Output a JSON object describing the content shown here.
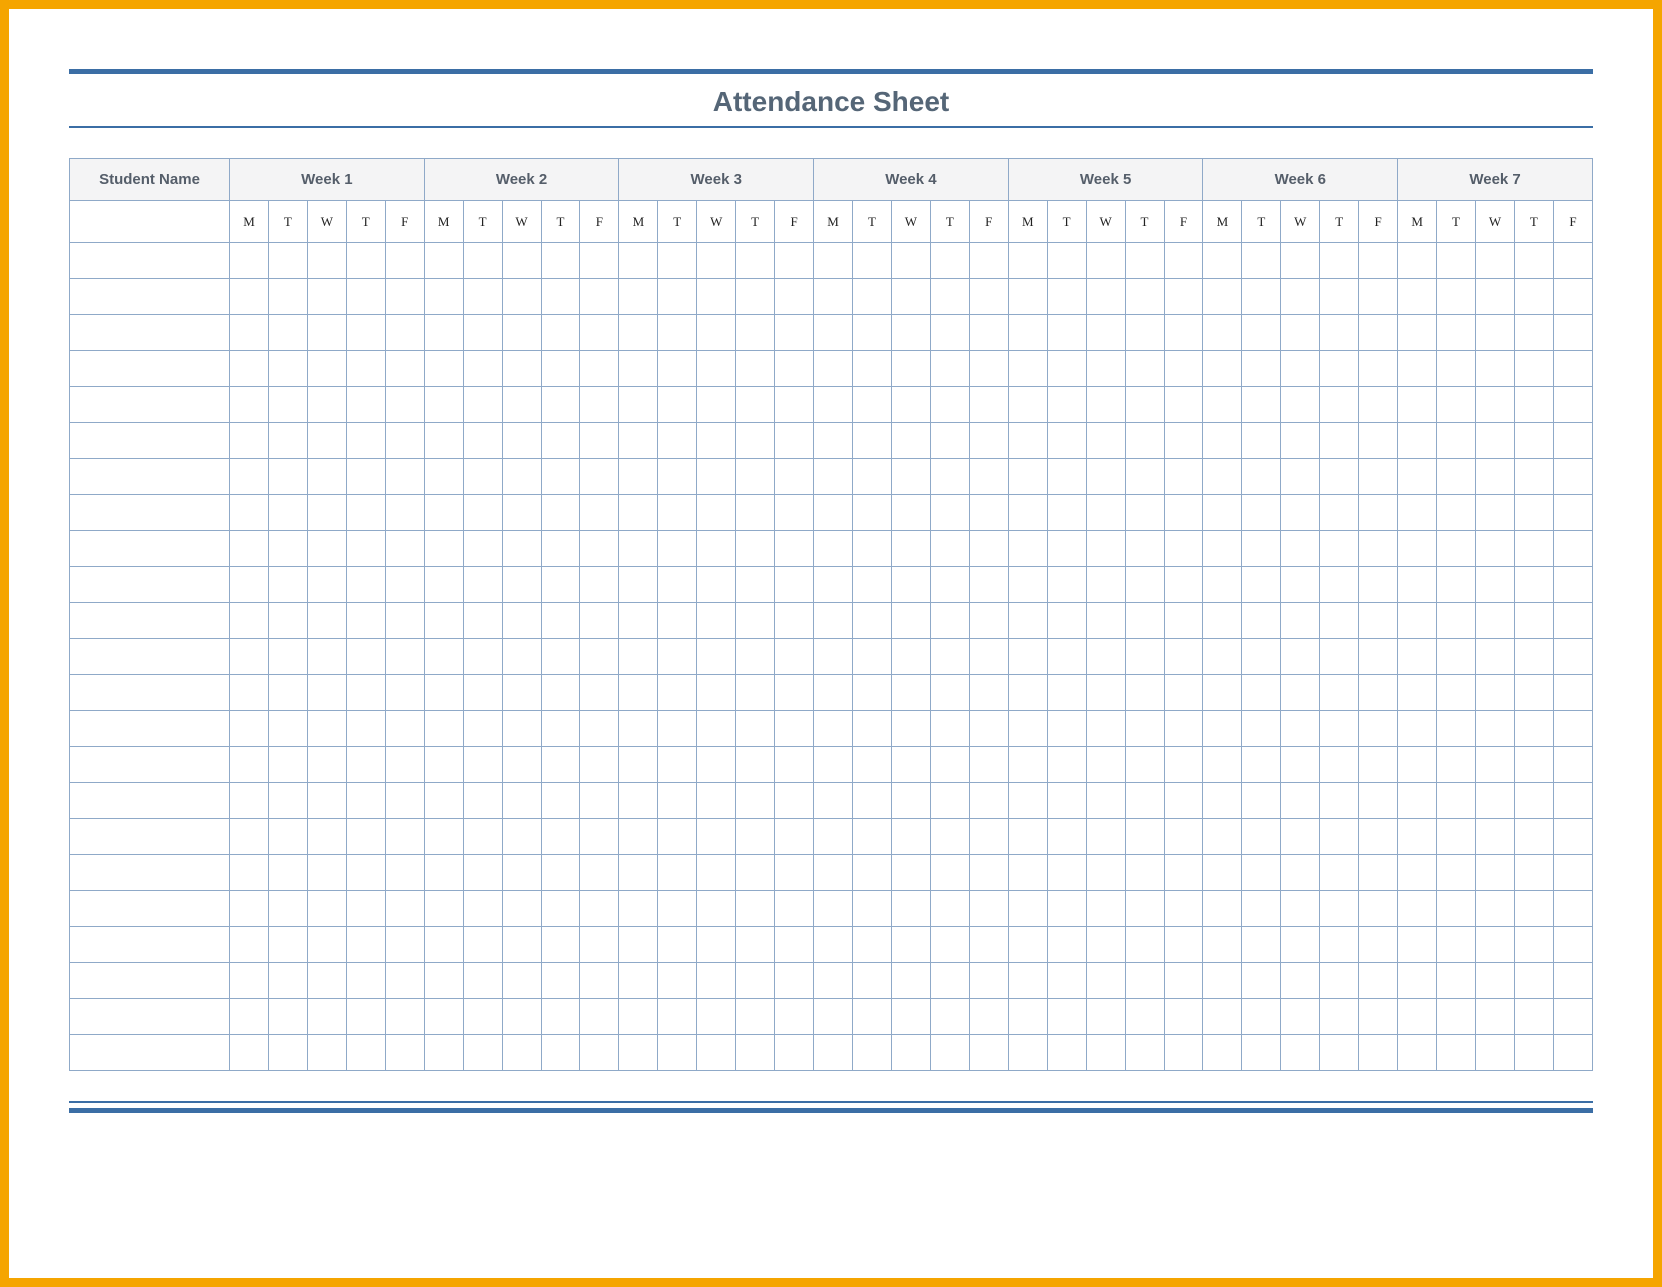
{
  "title": "Attendance Sheet",
  "columns": {
    "name_header": "Student Name",
    "weeks": [
      "Week 1",
      "Week 2",
      "Week 3",
      "Week 4",
      "Week 5",
      "Week 6",
      "Week 7"
    ],
    "days": [
      "M",
      "T",
      "W",
      "T",
      "F"
    ]
  },
  "row_count": 23,
  "colors": {
    "frame_border": "#f5a500",
    "rule": "#3b6ea5",
    "grid_line": "#8fa9c8",
    "header_bg": "#f4f4f5",
    "header_text": "#555e6a"
  }
}
